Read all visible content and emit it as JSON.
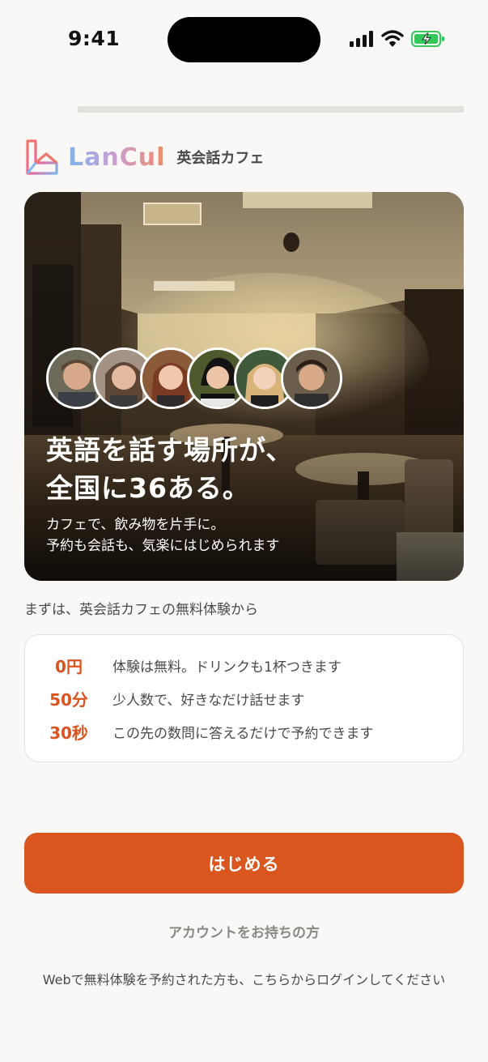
{
  "status": {
    "time": "9:41"
  },
  "progress": {
    "fraction": 0.0
  },
  "brand": {
    "name": "LanCul",
    "subtitle": "英会話カフェ"
  },
  "hero": {
    "title_line1": "英語を話す場所が、",
    "title_line2": "全国に36ある。",
    "subtitle_line1": "カフェで、飲み物を片手に。",
    "subtitle_line2": "予約も会話も、気楽にはじめられます",
    "avatar_count": 6
  },
  "lead": "まずは、英会話カフェの無料体験から",
  "features": [
    {
      "key": "0円",
      "text": "体験は無料。ドリンクも1杯つきます"
    },
    {
      "key": "50分",
      "text": "少人数で、好きなだけ話せます"
    },
    {
      "key": "30秒",
      "text": "この先の数問に答えるだけで予約できます"
    }
  ],
  "actions": {
    "start_label": "はじめる",
    "login_label": "アカウントをお持ちの方",
    "login_note": "Webで無料体験を予約された方も、こちらからログインしてください"
  },
  "colors": {
    "accent": "#d9561f",
    "background": "#f9f8f6",
    "card_border": "#e3e1dc"
  },
  "icons": [
    "signal-icon",
    "wifi-icon",
    "battery-charging-icon",
    "lancul-logo-icon"
  ]
}
